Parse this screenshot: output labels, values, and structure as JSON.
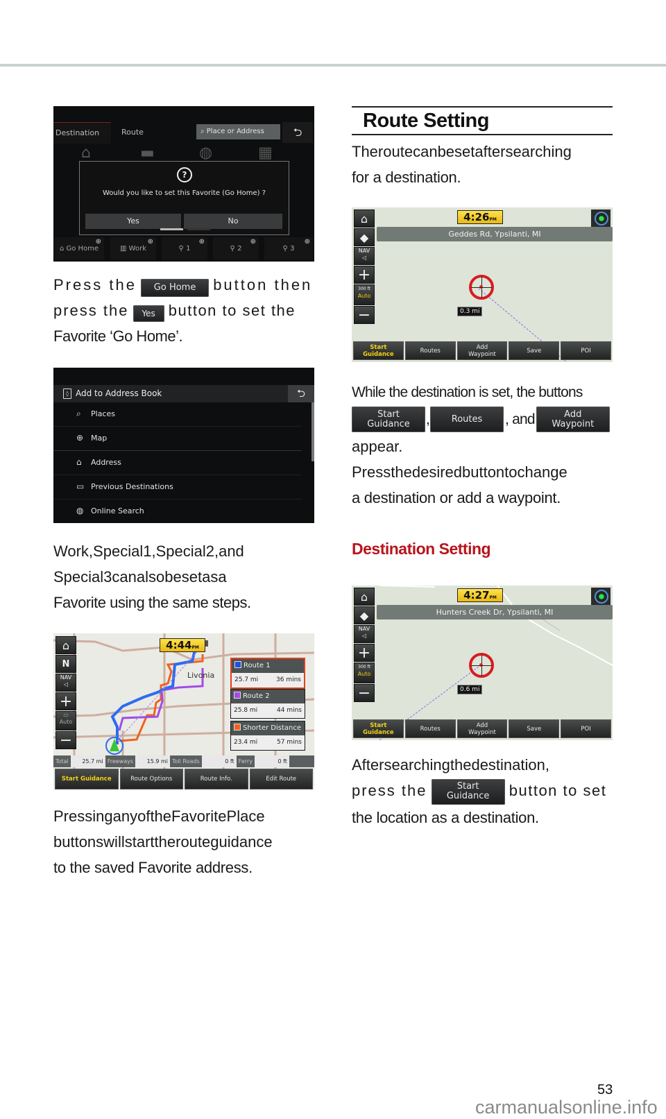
{
  "page": {
    "page_number": "53",
    "watermark": "carmanualsonline.info"
  },
  "left_column": {
    "favorite_screen": {
      "tabs": [
        "Destination",
        "Route"
      ],
      "search_placeholder": "Place or Address",
      "back_icon": "back-arrow-icon",
      "dialog": {
        "icon": "question-icon",
        "message": "Would you like to set this Favorite (Go Home) ?",
        "yes_label": "Yes",
        "no_label": "No"
      },
      "favorites": [
        {
          "label": "Go Home",
          "icon": "home-icon"
        },
        {
          "label": "Work",
          "icon": "building-icon"
        },
        {
          "label": "1",
          "icon": "pin-icon"
        },
        {
          "label": "2",
          "icon": "pin-icon"
        },
        {
          "label": "3",
          "icon": "pin-icon"
        }
      ]
    },
    "para1": {
      "line1_a": "Press the",
      "inline_btn1": "Go Home",
      "line1_b": "button then",
      "line2_a": "press the",
      "inline_btn2": "Yes",
      "line2_b": "button to set the",
      "line3": "Favorite ‘Go Home’."
    },
    "address_book_screen": {
      "title": "Add to Address Book",
      "items": [
        {
          "label": "Places",
          "icon": "search-place-icon"
        },
        {
          "label": "Map",
          "icon": "map-icon"
        },
        {
          "label": "Address",
          "icon": "address-icon"
        },
        {
          "label": "Previous Destinations",
          "icon": "folder-clock-icon"
        },
        {
          "label": "Online Search",
          "icon": "globe-search-icon"
        }
      ]
    },
    "para2": {
      "line1": [
        "Work,",
        "Special",
        "1,",
        "Special",
        "2,",
        "and"
      ],
      "line2": [
        "Special",
        "3",
        "can",
        "also",
        "be",
        "set",
        "as",
        "a"
      ],
      "line3": "Favorite using the same steps."
    },
    "route_screen": {
      "clock": "4:44",
      "clock_suffix": "PM",
      "place_label": "Livonia",
      "routes": [
        {
          "name": "Route 1",
          "distance": "25.7 mi",
          "time": "36 mins",
          "color": "#1f4fe0",
          "selected": true
        },
        {
          "name": "Route 2",
          "distance": "25.8 mi",
          "time": "44 mins",
          "color": "#a24be6",
          "selected": false
        },
        {
          "name": "Shorter Distance",
          "distance": "23.4 mi",
          "time": "57 mins",
          "color": "#f0621e",
          "selected": false
        }
      ],
      "stats": [
        {
          "key": "Total",
          "value": "25.7 mi"
        },
        {
          "key": "Freeways",
          "value": "15.9 mi"
        },
        {
          "key": "Toll Roads",
          "value": "0 ft"
        },
        {
          "key": "Ferry",
          "value": "0 ft"
        }
      ],
      "buttons": [
        "Start Guidance",
        "Route Options",
        "Route Info.",
        "Edit Route"
      ]
    },
    "para3": {
      "line1": "Pressing any of the Favorite Place",
      "line2": "buttons will start the route guidance",
      "line3": "to the saved Favorite address."
    }
  },
  "right_column": {
    "heading": "Route Setting",
    "intro": {
      "line1": "The route can be set after searching",
      "line2": "for a destination."
    },
    "map1": {
      "clock": "4:26",
      "clock_suffix": "PM",
      "address": "Geddes Rd, Ypsilanti, MI",
      "distance": "0.3 mi",
      "side_buttons": [
        "home-icon",
        "compass-icon",
        "nav-volume-icon",
        "zoom-in-icon",
        "scale-auto-icon",
        "zoom-out-icon"
      ],
      "scale_label": "300 ft",
      "auto_label": "Auto",
      "nav_label": "NAV",
      "buttons": [
        {
          "line1": "Start",
          "line2": "Guidance"
        },
        {
          "line1": "Routes",
          "line2": ""
        },
        {
          "line1": "Add",
          "line2": "Waypoint"
        },
        {
          "line1": "Save",
          "line2": ""
        },
        {
          "line1": "POI",
          "line2": ""
        }
      ]
    },
    "para1": {
      "line1": "While the destination is set, the buttons",
      "btn_a_1": "Start",
      "btn_a_2": "Guidance",
      "sep1": ",",
      "btn_b": "Routes",
      "sep2": ", and",
      "btn_c_1": "Add",
      "btn_c_2": "Waypoint",
      "line3": "appear.",
      "line4": "Press the desired button to change",
      "line5": "a destination or add a waypoint."
    },
    "subheading": "Destination Setting",
    "map2": {
      "clock": "4:27",
      "clock_suffix": "PM",
      "address": "Hunters Creek Dr, Ypsilanti, MI",
      "distance": "0.6 mi",
      "scale_label": "300 ft",
      "auto_label": "Auto",
      "nav_label": "NAV",
      "buttons": [
        {
          "line1": "Start",
          "line2": "Guidance"
        },
        {
          "line1": "Routes",
          "line2": ""
        },
        {
          "line1": "Add",
          "line2": "Waypoint"
        },
        {
          "line1": "Save",
          "line2": ""
        },
        {
          "line1": "POI",
          "line2": ""
        }
      ]
    },
    "para2": {
      "line1": "After searching the destination,",
      "line2_a": "press the",
      "btn_1": "Start",
      "btn_2": "Guidance",
      "line2_b": "button to set",
      "line3": "the location as a destination."
    }
  }
}
